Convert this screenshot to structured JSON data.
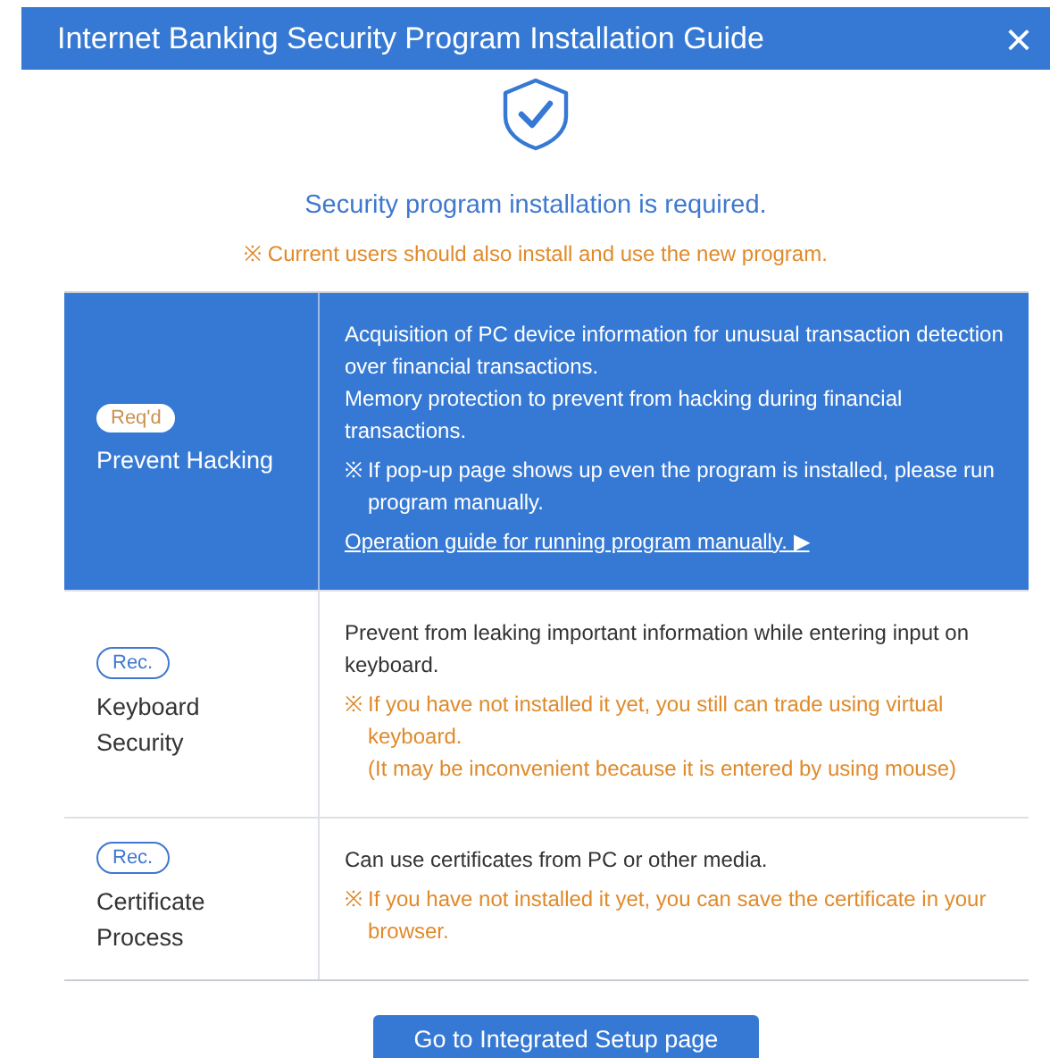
{
  "window": {
    "title": "Internet Banking Security Program Installation Guide",
    "close": "×"
  },
  "heading": "Security program installation is required.",
  "subnote": {
    "mark": "※",
    "text": "Current users should also install and use the new program."
  },
  "rows": [
    {
      "selected": true,
      "badge": {
        "kind": "required",
        "label": "Req'd"
      },
      "name": "Prevent Hacking",
      "items": [
        {
          "kind": "text",
          "text": "Acquisition of PC device information for unusual transaction detection over financial transactions."
        },
        {
          "kind": "text",
          "text": "Memory protection to prevent from hacking during financial transactions."
        },
        {
          "kind": "note",
          "mark": "※",
          "lines": [
            "If pop-up page shows up even the program is installed, please run program manually."
          ]
        },
        {
          "kind": "link",
          "text": "Operation guide for running program manually. ▶"
        }
      ]
    },
    {
      "selected": false,
      "badge": {
        "kind": "recommended",
        "label": "Rec."
      },
      "name": "Keyboard Security",
      "items": [
        {
          "kind": "text",
          "text": "Prevent from leaking important information while entering input on keyboard."
        },
        {
          "kind": "note",
          "mark": "※",
          "lines": [
            "If you have not installed it yet, you still can trade using virtual keyboard.",
            "(It may be inconvenient because it is entered by using mouse)"
          ]
        }
      ]
    },
    {
      "selected": false,
      "badge": {
        "kind": "recommended",
        "label": "Rec."
      },
      "name": "Certificate Process",
      "items": [
        {
          "kind": "text",
          "text": "Can use certificates from PC or other media."
        },
        {
          "kind": "note",
          "mark": "※",
          "lines": [
            "If you have not installed it yet, you can save the certificate in your browser."
          ]
        }
      ]
    }
  ],
  "button": "Go to Integrated Setup page"
}
